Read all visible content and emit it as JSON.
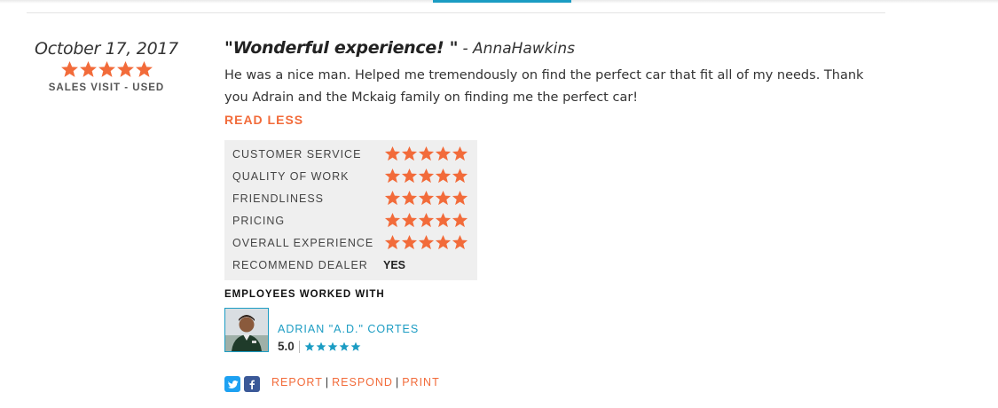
{
  "review": {
    "date": "October 17, 2017",
    "overall_rating": 5,
    "visit_type": "SALES VISIT - USED",
    "title": "\"Wonderful experience! \"",
    "author": "- AnnaHawkins",
    "body": "He was a nice man. Helped me tremendously on find the perfect car that fit all of my needs. Thank you Adrain and the Mckaig family on finding me the perfect car!",
    "read_less": "READ LESS"
  },
  "ratings": [
    {
      "label": "CUSTOMER SERVICE",
      "stars": 5
    },
    {
      "label": "QUALITY OF WORK",
      "stars": 5
    },
    {
      "label": "FRIENDLINESS",
      "stars": 5
    },
    {
      "label": "PRICING",
      "stars": 5
    },
    {
      "label": "OVERALL EXPERIENCE",
      "stars": 5
    },
    {
      "label": "RECOMMEND DEALER",
      "value": "YES"
    }
  ],
  "employees": {
    "heading": "EMPLOYEES WORKED WITH",
    "items": [
      {
        "name": "ADRIAN \"A.D.\" CORTES",
        "score": "5.0",
        "stars": 5
      }
    ]
  },
  "actions": {
    "twitter_icon": "twitter-icon",
    "facebook_icon": "facebook-icon",
    "report": "REPORT",
    "respond": "RESPOND",
    "print": "PRINT"
  },
  "colors": {
    "star": "#f26b3a",
    "accent_blue": "#1b9cc3",
    "link_orange": "#f26b3a",
    "panel_bg": "#efefef"
  }
}
